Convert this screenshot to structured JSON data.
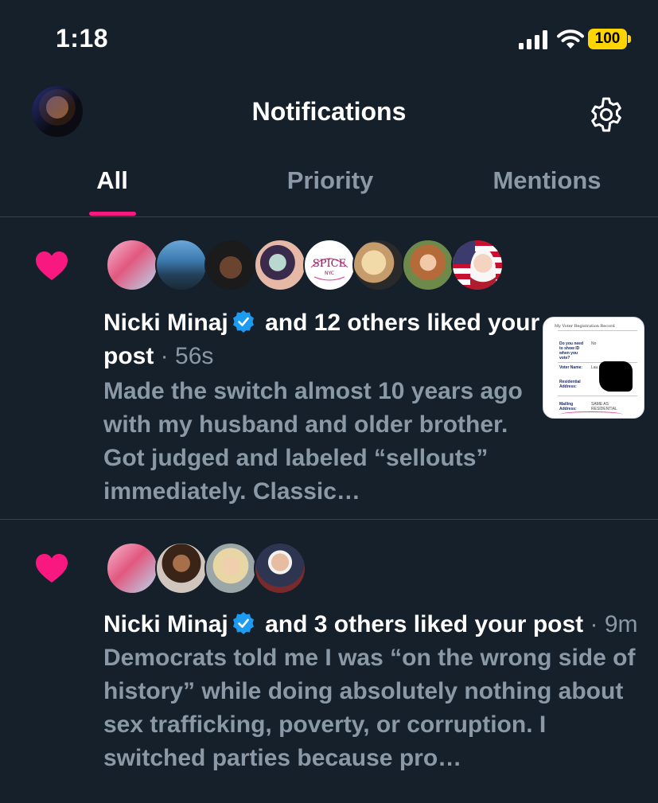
{
  "status_bar": {
    "time": "1:18",
    "battery_level": "100",
    "icons": [
      "signal-icon",
      "wifi-icon",
      "battery-icon"
    ]
  },
  "header": {
    "title": "Notifications",
    "icons": [
      "avatar",
      "gear-icon"
    ]
  },
  "tabs": [
    {
      "label": "All",
      "active": true
    },
    {
      "label": "Priority",
      "active": false
    },
    {
      "label": "Mentions",
      "active": false
    }
  ],
  "notifications": [
    {
      "icon": "heart-icon",
      "actor_name": "Nicki Minaj",
      "verified": true,
      "action": "and 12 others liked your post",
      "separator": "·",
      "time": "56s",
      "body": "Made the switch almost 10 years ago with my husband and older brother. Got judged and labeled “sellouts” immediately. Classic…",
      "avatar_badge_text": [
        "SPICE",
        "NYC"
      ],
      "thumbnail": {
        "title": "My Voter Registration Record",
        "rows": [
          {
            "label": "Do you need to show ID when you vote?",
            "value": "No"
          },
          {
            "label": "Voter Name:",
            "value": "Lau..."
          },
          {
            "label": "Residential Address:",
            "value": ""
          },
          {
            "label": "Mailing Address:",
            "value": "SAME AS RESIDENTIAL"
          }
        ]
      }
    },
    {
      "icon": "heart-icon",
      "actor_name": "Nicki Minaj",
      "verified": true,
      "action": "and 3 others liked your post",
      "separator": "·",
      "time": "9m",
      "body": "Democrats told me I was “on the wrong side of history” while doing absolutely nothing about sex trafficking, poverty, or corruption. I switched parties because pro…"
    }
  ],
  "colors": {
    "background": "#15202b",
    "accent_pink": "#f91880",
    "muted_text": "#8b98a5",
    "divider": "#38444d",
    "verified_blue": "#1d9bf0",
    "battery_yellow": "#ffd400"
  }
}
